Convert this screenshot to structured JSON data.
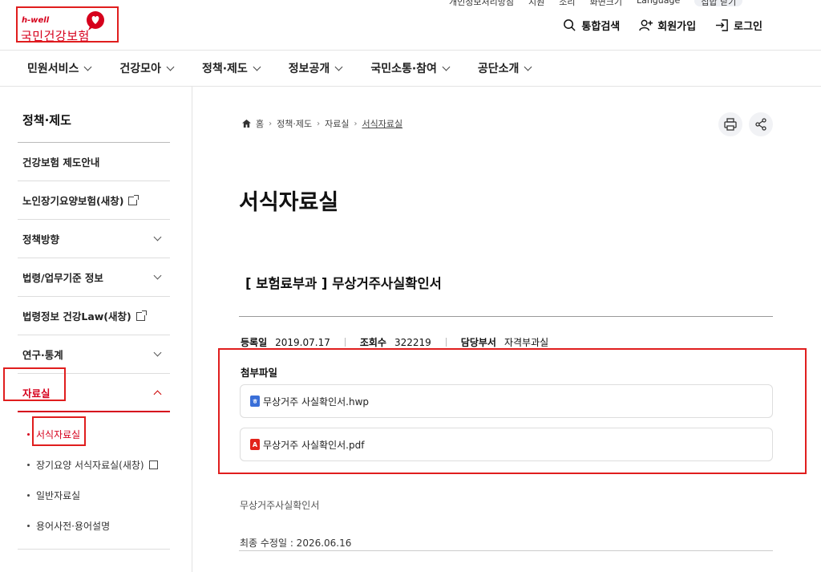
{
  "utility": [
    "개인정보처리방침",
    "지원",
    "소리",
    "화면크기",
    "Language",
    "집합 닫기"
  ],
  "logo": {
    "tagline": "h-well",
    "name": "국민건강보험"
  },
  "topnav": {
    "search": "통합검색",
    "join": "회원가입",
    "login": "로그인"
  },
  "gnb": [
    "민원서비스",
    "건강모아",
    "정책·제도",
    "정보공개",
    "국민소통·참여",
    "공단소개"
  ],
  "sidebar": {
    "title": "정책·제도",
    "items": [
      {
        "label": "건강보험 제도안내"
      },
      {
        "label": "노인장기요양보험(새창)"
      },
      {
        "label": "정책방향"
      },
      {
        "label": "법령/업무기준 정보"
      },
      {
        "label": "법령정보 건강Law(새창)"
      },
      {
        "label": "연구·통계"
      },
      {
        "label": "자료실"
      }
    ],
    "sub": [
      "서식자료실",
      "장기요양 서식자료실(새창)",
      "일반자료실",
      "용어사전·용어설명"
    ]
  },
  "breadcrumb": [
    "홈",
    "정책·제도",
    "자료실",
    "서식자료실"
  ],
  "page_title": "서식자료실",
  "doc": {
    "title": "[ 보험료부과 ] 무상거주사실확인서",
    "reg_label": "등록일",
    "reg_date": "2019.07.17",
    "views_label": "조회수",
    "views": "322219",
    "dept_label": "담당부서",
    "dept": "자격부과실",
    "attach_label": "첨부파일",
    "files": [
      {
        "name": "무상거주 사실확인서.hwp",
        "type": "hwp",
        "color": "#3a6fd8"
      },
      {
        "name": "무상거주 사실확인서.pdf",
        "type": "pdf",
        "color": "#e2231a"
      }
    ],
    "description": "무상거주사실확인서",
    "modified": "최종 수정일 : 2026.06.16"
  },
  "colors": {
    "accent": "#d6001c",
    "highlight_box": "#e01e1e"
  }
}
